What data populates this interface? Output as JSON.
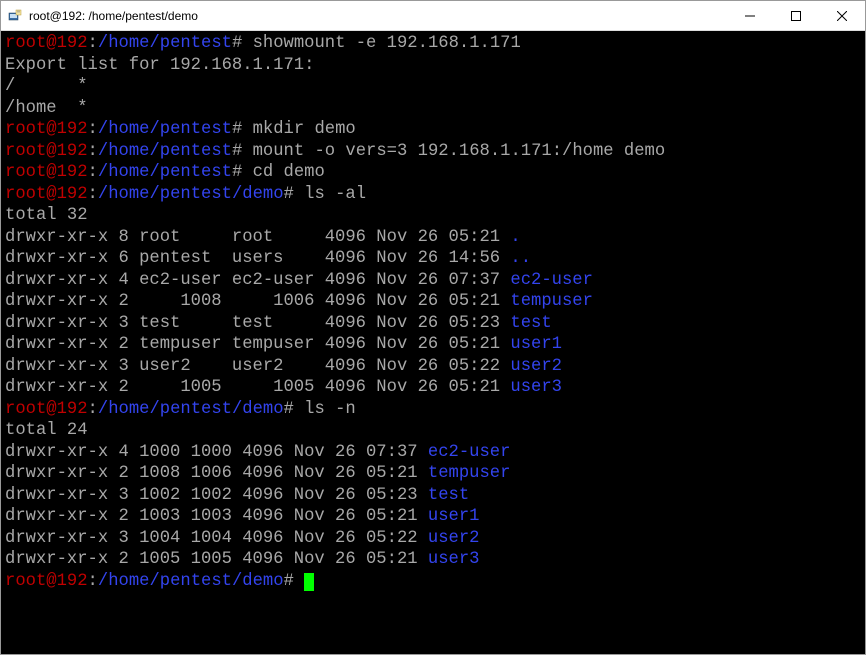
{
  "window": {
    "title": "root@192: /home/pentest/demo"
  },
  "prompt": {
    "user": "root",
    "at": "@",
    "host": "192",
    "colon": ":",
    "hash": "#"
  },
  "paths": {
    "pentest": "/home/pentest",
    "demo": "/home/pentest/demo"
  },
  "commands": {
    "c1": " showmount -e 192.168.1.171",
    "exportline": "Export list for 192.168.1.171:",
    "e1": "/      *",
    "e2": "/home  *",
    "c2": " mkdir demo",
    "c3": " mount -o vers=3 192.168.1.171:/home demo",
    "c4": " cd demo",
    "c5": " ls -al",
    "c6": " ls -n"
  },
  "ls_al": {
    "total": "total 32",
    "rows": [
      {
        "perm": "drwxr-xr-x 8 root     root     4096 Nov 26 05:21 ",
        "name": "."
      },
      {
        "perm": "drwxr-xr-x 6 pentest  users    4096 Nov 26 14:56 ",
        "name": ".."
      },
      {
        "perm": "drwxr-xr-x 4 ec2-user ec2-user 4096 Nov 26 07:37 ",
        "name": "ec2-user"
      },
      {
        "perm": "drwxr-xr-x 2     1008     1006 4096 Nov 26 05:21 ",
        "name": "tempuser"
      },
      {
        "perm": "drwxr-xr-x 3 test     test     4096 Nov 26 05:23 ",
        "name": "test"
      },
      {
        "perm": "drwxr-xr-x 2 tempuser tempuser 4096 Nov 26 05:21 ",
        "name": "user1"
      },
      {
        "perm": "drwxr-xr-x 3 user2    user2    4096 Nov 26 05:22 ",
        "name": "user2"
      },
      {
        "perm": "drwxr-xr-x 2     1005     1005 4096 Nov 26 05:21 ",
        "name": "user3"
      }
    ]
  },
  "ls_n": {
    "total": "total 24",
    "rows": [
      {
        "perm": "drwxr-xr-x 4 1000 1000 4096 Nov 26 07:37 ",
        "name": "ec2-user"
      },
      {
        "perm": "drwxr-xr-x 2 1008 1006 4096 Nov 26 05:21 ",
        "name": "tempuser"
      },
      {
        "perm": "drwxr-xr-x 3 1002 1002 4096 Nov 26 05:23 ",
        "name": "test"
      },
      {
        "perm": "drwxr-xr-x 2 1003 1003 4096 Nov 26 05:21 ",
        "name": "user1"
      },
      {
        "perm": "drwxr-xr-x 3 1004 1004 4096 Nov 26 05:22 ",
        "name": "user2"
      },
      {
        "perm": "drwxr-xr-x 2 1005 1005 4096 Nov 26 05:21 ",
        "name": "user3"
      }
    ]
  }
}
